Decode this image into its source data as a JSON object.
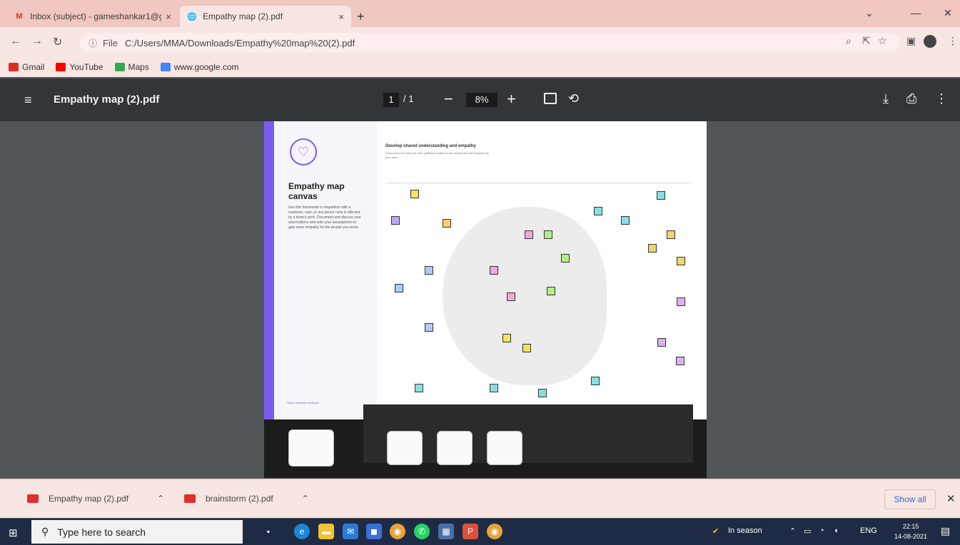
{
  "browser": {
    "tabs": [
      {
        "title": "Inbox (subject) - gameshankar1@g",
        "close": "×"
      },
      {
        "title": "Empathy map (2).pdf",
        "close": "×"
      }
    ],
    "new_tab": "+",
    "window_controls": [
      "⌄",
      "—",
      "✕"
    ],
    "url_scheme_label": "File",
    "url": "C:/Users/MMA/Downloads/Empathy%20map%20(2).pdf",
    "bookmarks": [
      {
        "label": "Gmail",
        "color": "#d93025"
      },
      {
        "label": "YouTube",
        "color": "#ff0000"
      },
      {
        "label": "Maps",
        "color": "#34a853"
      },
      {
        "label": "www.google.com",
        "color": "#4285f4"
      }
    ]
  },
  "pdf_viewer": {
    "file_name": "Empathy map (2).pdf",
    "current_page": "1",
    "total_pages": "/ 1",
    "zoom": "8%",
    "page": {
      "title": "Empathy map canvas",
      "description": "Use this framework to empathize with a customer, user, or any person who is affected by a team's work. Document and discuss your observations and note your assumptions to gain more empathy for the people you serve.",
      "right_title": "Develop shared understanding and empathy",
      "right_sub": "Summarize the data you have gathered related to the people that are impacted by your work.",
      "footer_link": "Share template feedback"
    }
  },
  "downloads": {
    "items": [
      {
        "name": "Empathy map (2).pdf"
      },
      {
        "name": "brainstorm (2).pdf"
      }
    ],
    "show_all": "Show all",
    "close": "✕"
  },
  "taskbar": {
    "search_placeholder": "Type here to search",
    "weather": "In season",
    "language": "ENG",
    "time": "22:15",
    "date": "14-08-2021"
  },
  "colors": {
    "accent": "#7b5cf0",
    "tab_strip": "#f1c7c1",
    "pdf_toolbar": "#323639",
    "viewer_bg": "#525659",
    "taskbar": "#1f2b44"
  }
}
